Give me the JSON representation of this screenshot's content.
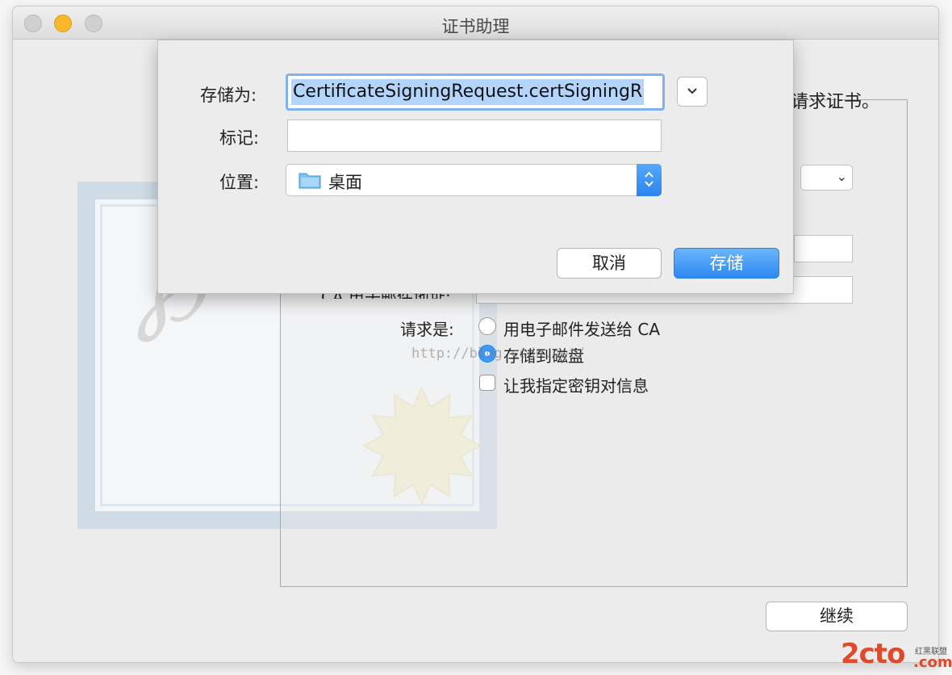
{
  "window": {
    "title": "证书助理"
  },
  "background": {
    "intro_text": "请求证书。",
    "ca_email_label": "CA 电子邮件地址:",
    "request_label": "请求是:",
    "options": {
      "email_to_ca": "用电子邮件发送给 CA",
      "save_to_disk": "存储到磁盘",
      "specify_key_pair": "让我指定密钥对信息"
    },
    "selected_option": "save_to_disk",
    "specify_key_pair_checked": false,
    "continue_label": "继续",
    "watermark_url": "http://blog.csdn.net/"
  },
  "save_sheet": {
    "save_as_label": "存储为:",
    "save_as_value": "CertificateSigningRequest.certSigningR",
    "tags_label": "标记:",
    "tags_value": "",
    "where_label": "位置:",
    "where_value": "桌面",
    "cancel_label": "取消",
    "save_label": "存储"
  },
  "site_logo": {
    "brand": "2cto",
    "domain": ".com",
    "tagline": "红黑联盟"
  },
  "colors": {
    "accent": "#3b99fc",
    "minimize": "#f9b72c",
    "logo": "#e1492b"
  }
}
